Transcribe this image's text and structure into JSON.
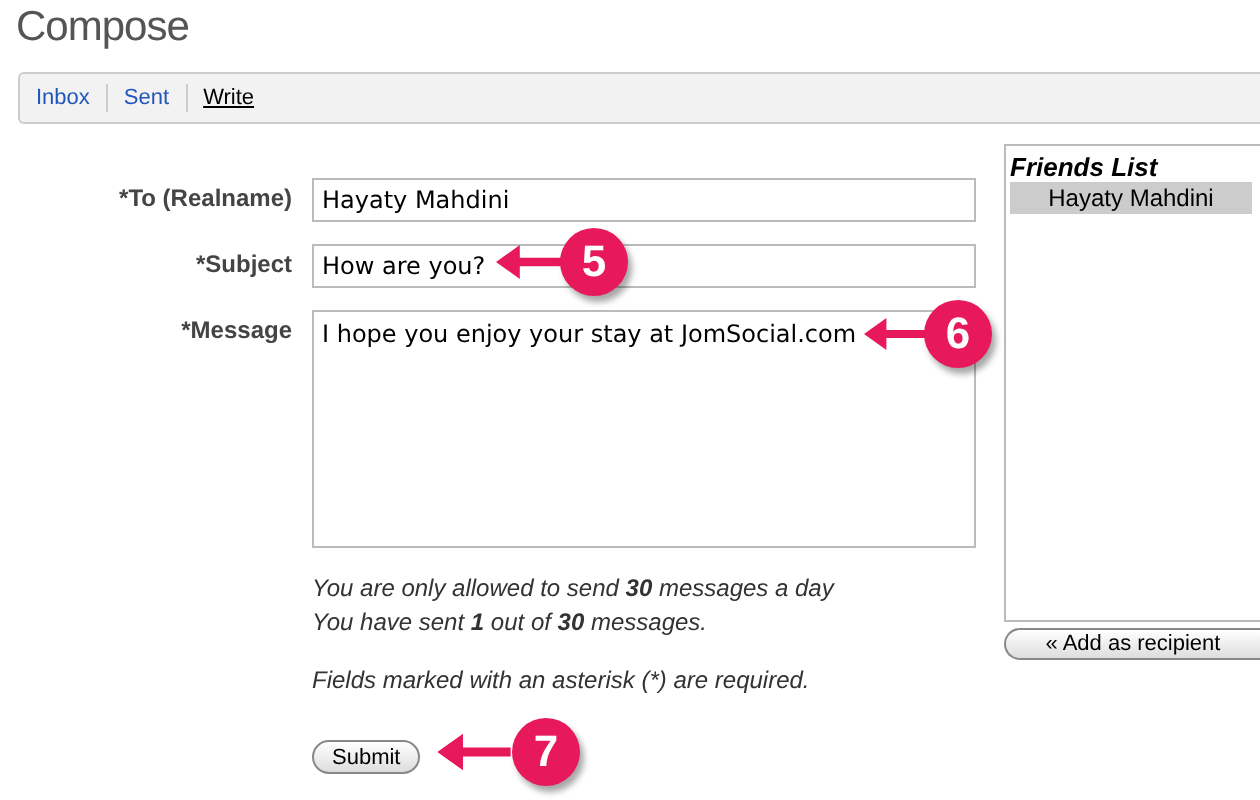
{
  "page": {
    "title": "Compose"
  },
  "nav": [
    {
      "label": "Inbox",
      "selected": false
    },
    {
      "label": "Sent",
      "selected": false
    },
    {
      "label": "Write",
      "selected": true
    }
  ],
  "form": {
    "fields": [
      {
        "label": "*To (Realname)",
        "kind": "input",
        "value": "Hayaty Mahdini"
      },
      {
        "label": "*Subject",
        "kind": "input",
        "value": "How are you?"
      },
      {
        "label": "*Message",
        "kind": "textarea",
        "value": "I hope you enjoy your stay at JomSocial.com"
      }
    ],
    "limits": [
      "You are only allowed to send **30** messages a day",
      "You have sent **1** out of **30** messages."
    ],
    "required_note": "Fields marked with an asterisk (*) are required.",
    "submit": "Submit"
  },
  "friends": {
    "title": "Friends List",
    "items": [
      {
        "name": "Hayaty Mahdini",
        "selected": true
      }
    ],
    "add_button": "« Add as recipient"
  },
  "callouts": [
    {
      "number": "5"
    },
    {
      "number": "6"
    },
    {
      "number": "7"
    }
  ]
}
